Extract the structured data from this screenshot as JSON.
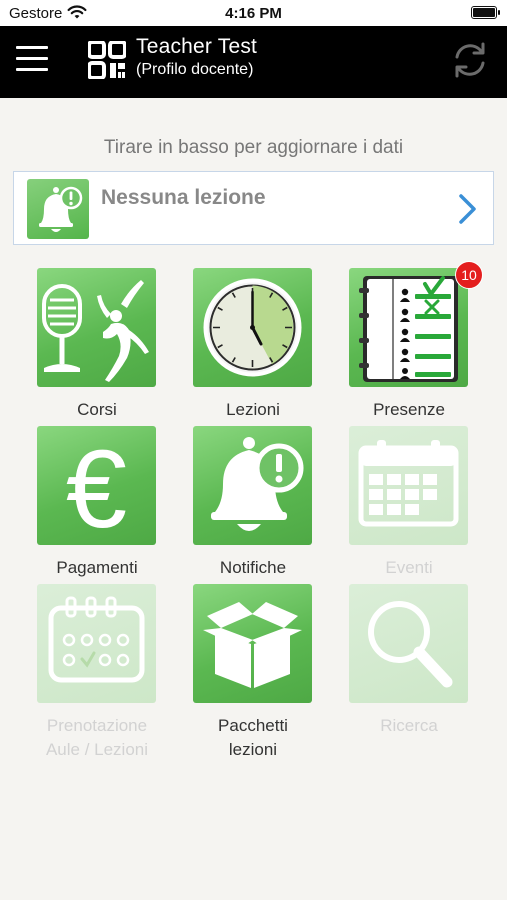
{
  "status_bar": {
    "carrier": "Gestore",
    "time": "4:16 PM"
  },
  "header": {
    "title": "Teacher Test",
    "subtitle": "(Profilo docente)"
  },
  "hint": "Tirare in basso per aggiornare i dati",
  "lesson_card": {
    "text": "Nessuna lezione"
  },
  "tiles": {
    "corsi": {
      "label": "Corsi",
      "enabled": true
    },
    "lezioni": {
      "label": "Lezioni",
      "enabled": true
    },
    "presenze": {
      "label": "Presenze",
      "enabled": true,
      "badge": "10"
    },
    "pagamenti": {
      "label": "Pagamenti",
      "enabled": true
    },
    "notifiche": {
      "label": "Notifiche",
      "enabled": true
    },
    "eventi": {
      "label": "Eventi",
      "enabled": false
    },
    "prenotazione": {
      "label_line1": "Prenotazione",
      "label_line2": "Aule / Lezioni",
      "enabled": false
    },
    "pacchetti": {
      "label_line1": "Pacchetti",
      "label_line2": "lezioni",
      "enabled": true
    },
    "ricerca": {
      "label": "Ricerca",
      "enabled": false
    }
  },
  "icons": {
    "menu": "hamburger-menu-icon",
    "qr": "qr-code-icon",
    "refresh": "refresh-icon",
    "bell_alert": "bell-alert-icon",
    "chevron": "chevron-right-icon"
  },
  "colors": {
    "accent_green": "#5bb851",
    "badge_red": "#e41e1e",
    "chevron_blue": "#3a8fd6",
    "header_bg": "#000000"
  }
}
